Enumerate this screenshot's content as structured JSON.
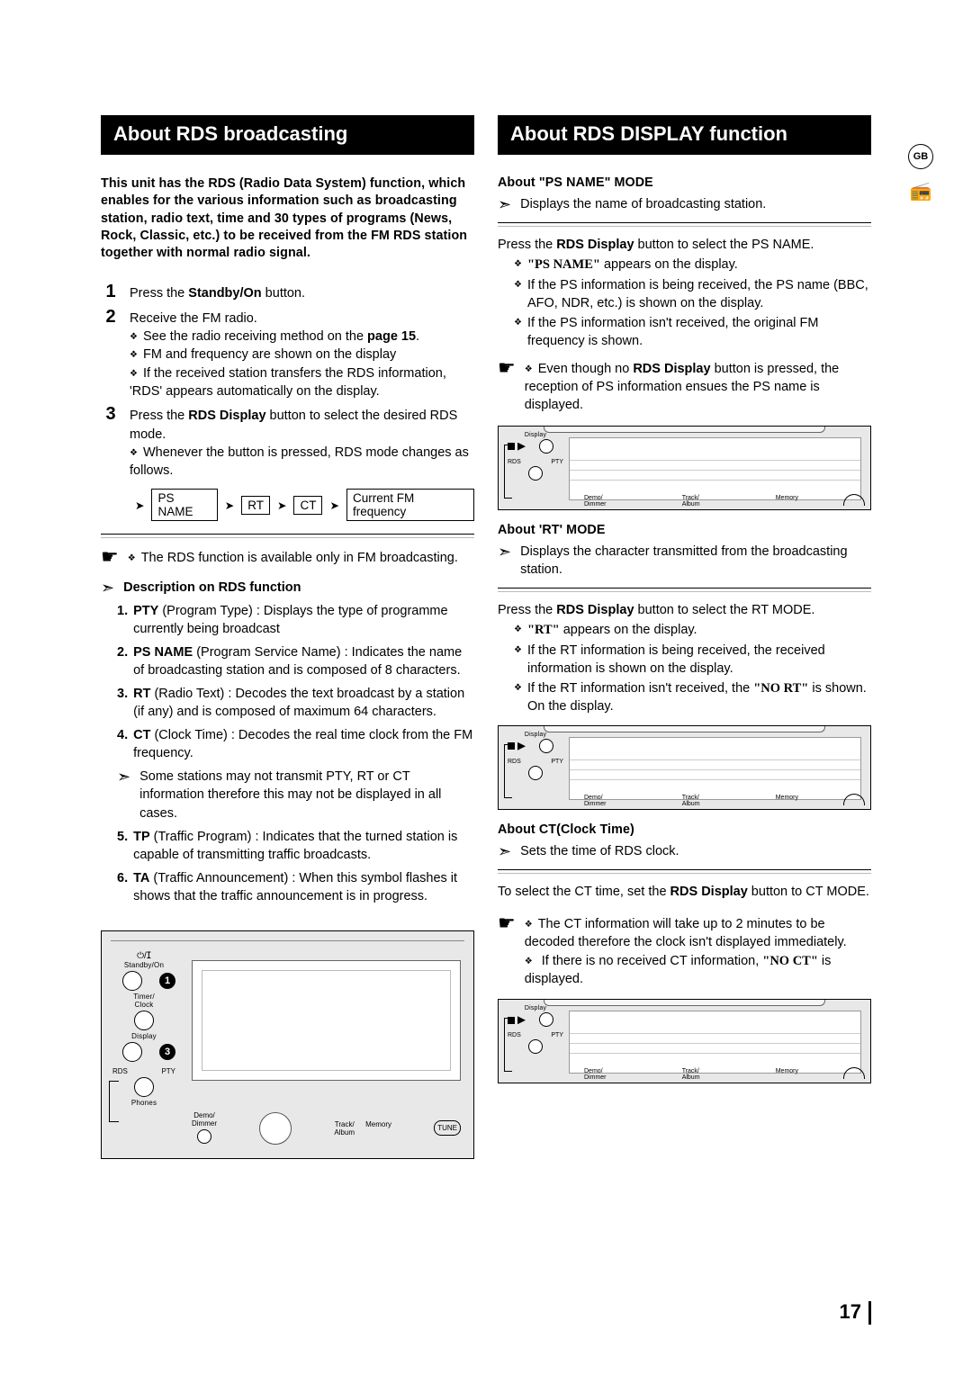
{
  "page_number": "17",
  "region_badge": "GB",
  "left": {
    "title": "About RDS broadcasting",
    "intro": "This unit has the RDS (Radio Data System) function, which enables for the various information such as broadcasting station, radio text, time and 30 types of programs (News, Rock, Classic, etc.) to be received from the FM RDS station together with normal radio signal.",
    "steps": {
      "s1": {
        "num": "1",
        "text_pre": "Press the ",
        "bold": "Standby/On",
        "text_post": " button."
      },
      "s2": {
        "num": "2",
        "text": "Receive the FM radio.",
        "sub1_pre": "See the radio receiving method on the ",
        "sub1_bold": "page 15",
        "sub1_post": ".",
        "sub2": "FM and frequency are shown on the display",
        "sub3": "If the received station transfers the RDS information, 'RDS' appears automatically on the display."
      },
      "s3": {
        "num": "3",
        "text_pre": "Press the ",
        "bold": "RDS Display",
        "text_post": " button to select the desired RDS mode.",
        "sub1": "Whenever the button is pressed, RDS mode changes as follows."
      }
    },
    "flow": {
      "a": "PS NAME",
      "b": "RT",
      "c": "CT",
      "d": "Current FM frequency"
    },
    "note1": "The RDS function is available  only in FM broadcasting.",
    "desc_head": "Description on RDS function",
    "desc": {
      "d1": {
        "n": "1.",
        "b": "PTY",
        "t": " (Program Type) : Displays the type of programme currently being broadcast"
      },
      "d2": {
        "n": "2.",
        "b": "PS NAME",
        "t": " (Program Service Name) : Indicates the name of broadcasting station and is composed of 8 characters."
      },
      "d3": {
        "n": "3.",
        "b": "RT",
        "t": " (Radio Text) : Decodes the text broadcast by a station (if any) and is composed of maximum 64 characters."
      },
      "d4": {
        "n": "4.",
        "b": "CT",
        "t": " (Clock Time)  :  Decodes the real time clock from the FM frequency."
      },
      "d4_note": "Some stations may not transmit PTY, RT or CT information therefore this may not be displayed in all cases.",
      "d5": {
        "n": "5.",
        "b": "TP",
        "t": " (Traffic Program) : Indicates that the turned station is capable of transmitting traffic broadcasts."
      },
      "d6": {
        "n": "6.",
        "b": "TA",
        "t": " (Traffic Announcement) : When this symbol flashes it shows that the traffic announcement is in progress."
      }
    },
    "bigpanel": {
      "standby": "Standby/On",
      "timer": "Timer/\nClock",
      "display": "Display",
      "rds": "RDS",
      "pty": "PTY",
      "phones": "Phones",
      "demo": "Demo/\nDimmer",
      "track": "Track/\nAlbum",
      "memory": "Memory",
      "tune": "TUNE",
      "power_sym": "⏻/ⵊ",
      "callout1": "1",
      "callout3": "3"
    }
  },
  "right": {
    "title": "About RDS DISPLAY function",
    "ps": {
      "head": "About \"PS NAME\" MODE",
      "line": "Displays the name of broadcasting station.",
      "p_pre": "Press the ",
      "p_bold": "RDS Display",
      "p_post": "  button to select the PS NAME.",
      "b1_pre": "",
      "b1_q": "\"PS NAME\"",
      "b1_post": " appears on the display.",
      "b2": "If the PS information is being received, the PS name (BBC, AFO, NDR, etc.) is shown on the display.",
      "b3": "If the PS information isn't received, the original FM frequency is shown.",
      "note_pre": "Even though no ",
      "note_bold": "RDS Display",
      "note_post": " button is pressed, the reception of PS information ensues the PS name is displayed."
    },
    "rt": {
      "head": "About 'RT' MODE",
      "line": "Displays the character transmitted from the broadcasting station.",
      "p_pre": "Press the ",
      "p_bold": "RDS Display",
      "p_post": " button to select the RT MODE.",
      "b1_pre": "",
      "b1_q": "\"RT\"",
      "b1_post": " appears on the display.",
      "b2": "If the RT information is being received, the received information is shown on the display.",
      "b3_pre": "If the RT information isn't received, the ",
      "b3_q": "\"NO RT\"",
      "b3_post": " is shown. On the display."
    },
    "ct": {
      "head": "About CT(Clock   Time)",
      "line": "Sets the time of RDS clock.",
      "p_pre": "To select the CT time, set the ",
      "p_bold": "RDS Display",
      "p_post": " button to CT MODE.",
      "b1": "The CT information will take up to 2 minutes to be decoded therefore the clock isn't displayed immediately.",
      "b2_pre": " If there is no received CT information, ",
      "b2_q": "\"NO CT\"",
      "b2_post": " is displayed."
    },
    "panel_labels": {
      "display": "Display",
      "rds": "RDS",
      "pty": "PTY",
      "demo": "Demo/\nDimmer",
      "track": "Track/\nAlbum",
      "memory": "Memory"
    }
  }
}
